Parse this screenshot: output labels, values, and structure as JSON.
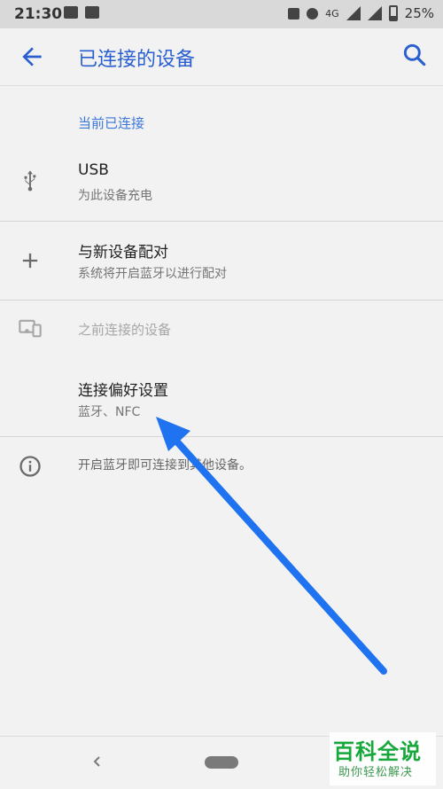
{
  "status_bar": {
    "time": "21:30",
    "battery": "25%",
    "network_label": "4G"
  },
  "app_bar": {
    "title": "已连接的设备"
  },
  "sections": {
    "current_header": "当前已连接",
    "previous_header": "之前连接的设备"
  },
  "rows": {
    "usb": {
      "primary": "USB",
      "secondary": "为此设备充电"
    },
    "pair": {
      "primary": "与新设备配对",
      "secondary": "系统将开启蓝牙以进行配对"
    },
    "preferences": {
      "primary": "连接偏好设置",
      "secondary": "蓝牙、NFC"
    }
  },
  "info": {
    "text": "开启蓝牙即可连接到其他设备。"
  },
  "watermark": {
    "title": "百科全说",
    "subtitle": "助你轻松解决"
  },
  "colors": {
    "accent": "#2a5fd0",
    "arrow": "#1f73f0",
    "watermark": "#16a83a"
  }
}
